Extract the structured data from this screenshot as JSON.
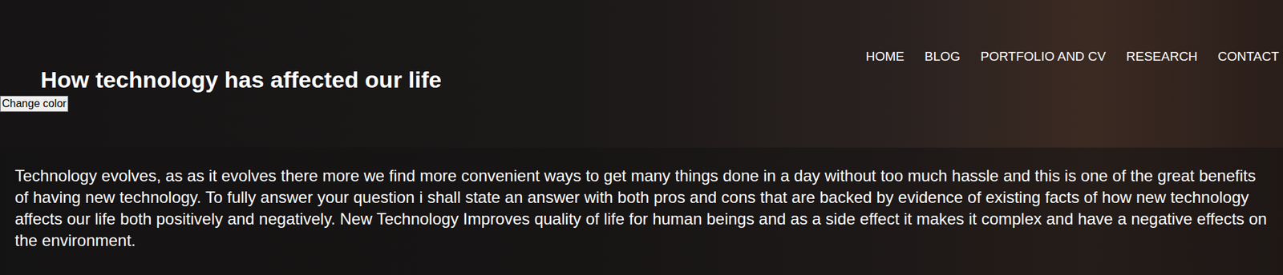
{
  "nav": {
    "items": [
      {
        "label": "HOME"
      },
      {
        "label": "BLOG"
      },
      {
        "label": "PORTFOLIO AND CV"
      },
      {
        "label": "RESEARCH"
      },
      {
        "label": "CONTACT"
      }
    ]
  },
  "page": {
    "title": "How technology has affected our life"
  },
  "color_button": {
    "label": "Change color"
  },
  "content": {
    "paragraphs": [
      "Technology evolves, as as it evolves there more we find more convenient ways to get many things done in a day without too much hassle and this is one of the great benefits of having new technology. To fully answer your question i shall state an answer with both pros and cons that are backed by evidence of existing facts of how new technology affects our life both positively and negatively. New Technology Improves quality of life for human beings and as a side effect it makes it complex and have a negative effects on the environment."
    ]
  }
}
